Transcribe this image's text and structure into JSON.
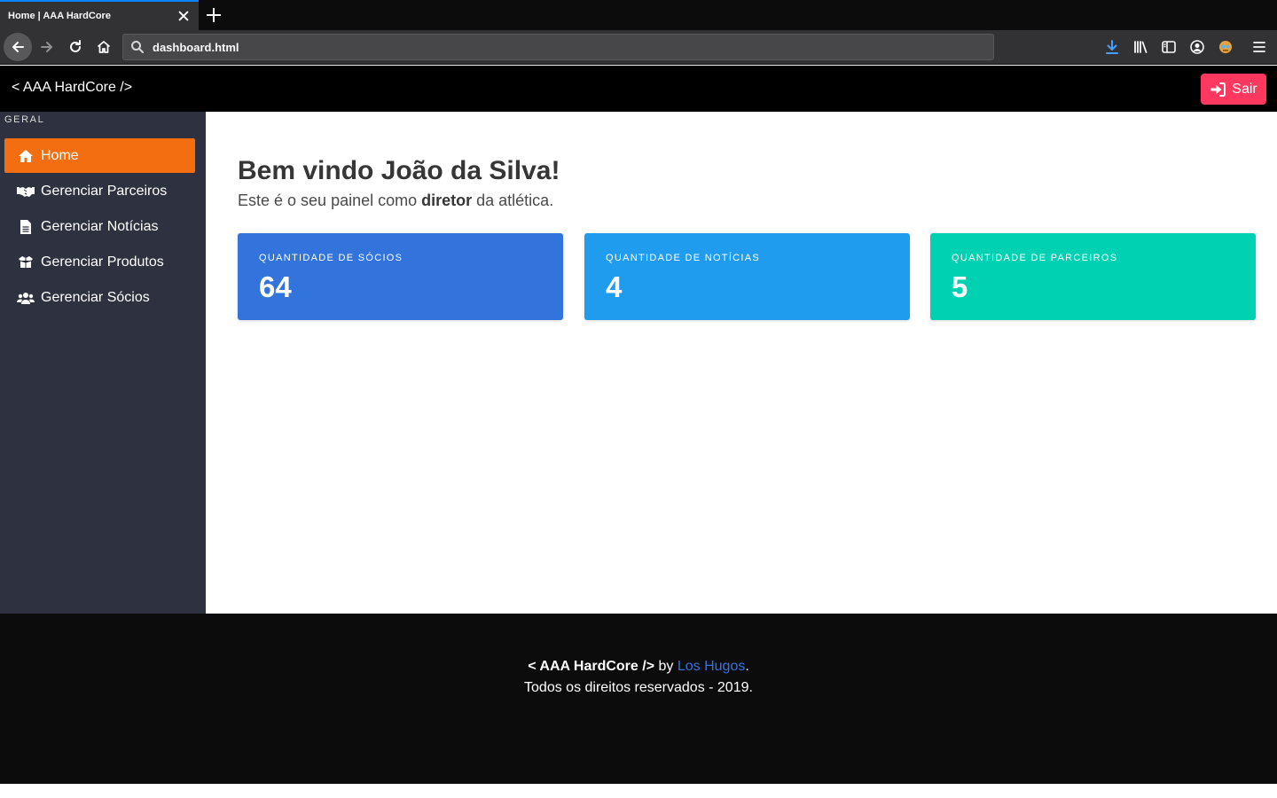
{
  "browser": {
    "tab_title": "Home | AAA HardCore",
    "url": "dashboard.html"
  },
  "header": {
    "brand": "< AAA HardCore />",
    "logout_label": "Sair"
  },
  "sidebar": {
    "section_label": "GERAL",
    "items": [
      {
        "label": "Home",
        "icon": "home-icon",
        "active": true
      },
      {
        "label": "Gerenciar Parceiros",
        "icon": "handshake-icon"
      },
      {
        "label": "Gerenciar Notícias",
        "icon": "file-icon"
      },
      {
        "label": "Gerenciar Produtos",
        "icon": "box-icon"
      },
      {
        "label": "Gerenciar Sócios",
        "icon": "users-icon"
      }
    ]
  },
  "main": {
    "welcome": "Bem vindo João da Silva!",
    "subtitle_pre": "Este é o seu painel como ",
    "subtitle_role": "diretor",
    "subtitle_post": " da atlética.",
    "cards": [
      {
        "label": "QUANTIDADE DE SÓCIOS",
        "value": "64",
        "color": "#3273dc"
      },
      {
        "label": "QUANTIDADE DE NOTÍCIAS",
        "value": "4",
        "color": "#209cee"
      },
      {
        "label": "QUANTIDADE DE PARCEIROS",
        "value": "5",
        "color": "#00d1b2"
      }
    ]
  },
  "footer": {
    "brand": "< AAA HardCore />",
    "by": " by ",
    "author": "Los Hugos",
    "period": ".",
    "rights": "Todos os direitos reservados - 2019."
  },
  "colors": {
    "accent": "#f26e11",
    "danger": "#ff3860",
    "link": "#3273dc"
  }
}
